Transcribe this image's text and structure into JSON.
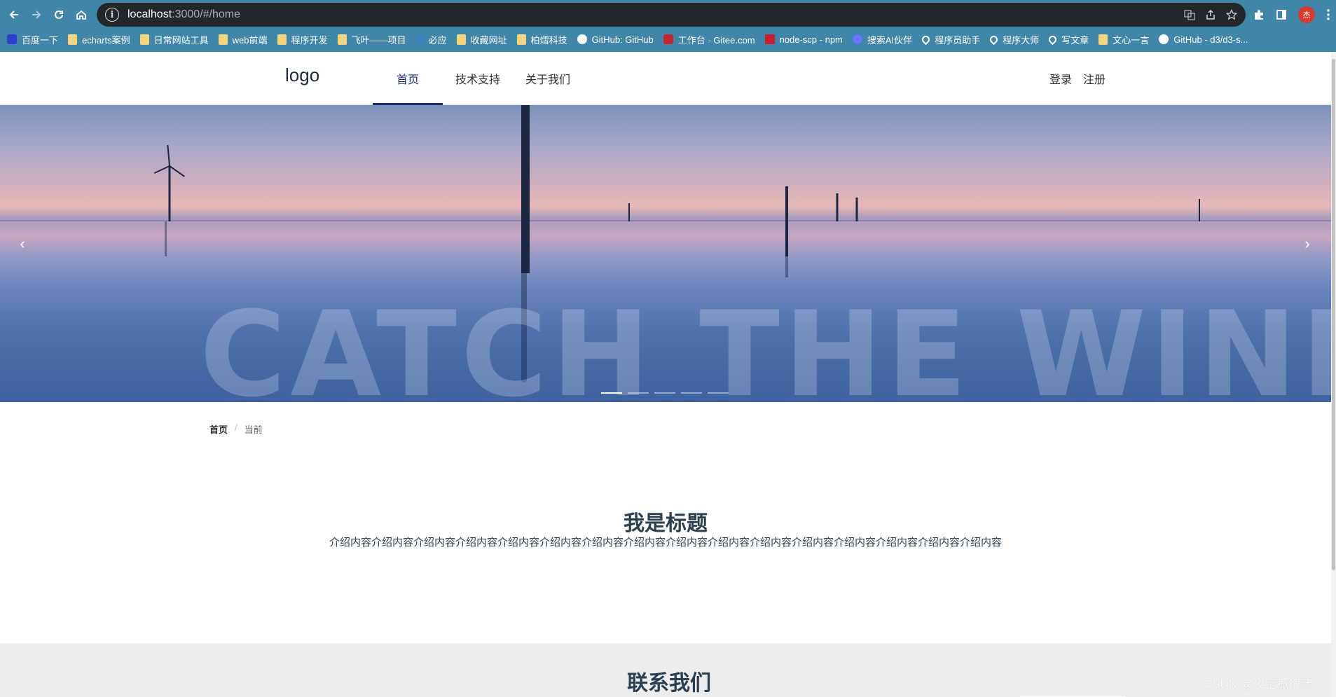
{
  "browser": {
    "url_host": "localhost",
    "url_path": ":3000/#/home",
    "icons": {
      "back": "arrow-left-icon",
      "forward": "arrow-right-icon",
      "reload": "reload-icon",
      "home": "home-icon",
      "info": "info-icon",
      "translate": "translate-icon",
      "share": "share-icon",
      "bookmark": "star-icon",
      "extensions": "puzzle-icon",
      "sidepanel": "side-panel-icon",
      "menu": "kebab-menu-icon"
    },
    "profile_initial": "杰",
    "bookmarks": [
      {
        "label": "百度一下",
        "icon": "blue"
      },
      {
        "label": "echarts案例",
        "icon": "folder"
      },
      {
        "label": "日常网站工具",
        "icon": "folder"
      },
      {
        "label": "web前端",
        "icon": "folder"
      },
      {
        "label": "程序开发",
        "icon": "folder"
      },
      {
        "label": "飞叶——项目",
        "icon": "folder"
      },
      {
        "label": "必应",
        "icon": "search"
      },
      {
        "label": "收藏网址",
        "icon": "folder"
      },
      {
        "label": "柏熠科技",
        "icon": "folder"
      },
      {
        "label": "GitHub: GitHub",
        "icon": "gh"
      },
      {
        "label": "工作台 - Gitee.com",
        "icon": "red"
      },
      {
        "label": "node-scp - npm",
        "icon": "redsq"
      },
      {
        "label": "搜索AI伙伴",
        "icon": "ai"
      },
      {
        "label": "程序员助手",
        "icon": "pin"
      },
      {
        "label": "程序大师",
        "icon": "pin"
      },
      {
        "label": "写文章",
        "icon": "pin"
      },
      {
        "label": "文心一言",
        "icon": "folder"
      },
      {
        "label": "GitHub - d3/d3-s...",
        "icon": "gh"
      }
    ]
  },
  "site": {
    "logo": "logo",
    "menu": [
      "首页",
      "技术支持",
      "关于我们"
    ],
    "auth": {
      "login": "登录",
      "register": "注册"
    },
    "carousel": {
      "slide_text": "CATCH THE WIND",
      "prev_icon": "chevron-left-icon",
      "next_icon": "chevron-right-icon",
      "prev_glyph": "‹",
      "next_glyph": "›",
      "indicator_count": 5,
      "active_index": 0
    },
    "breadcrumb": {
      "home": "首页",
      "separator": "/",
      "current": "当前"
    },
    "section": {
      "title": "我是标题",
      "intro": "介绍内容介绍内容介绍内容介绍内容介绍内容介绍内容介绍内容介绍内容介绍内容介绍内容介绍内容介绍内容介绍内容介绍内容介绍内容介绍内容"
    },
    "contact": {
      "title": "联系我们"
    }
  },
  "watermark": "CSDN @夜空孤狼啸",
  "colors": {
    "chrome": "#3f86a8",
    "omnibox": "#23272a",
    "menu_active": "#1e2a78",
    "heading": "#2c3e50",
    "contact_bg": "#ededed"
  }
}
